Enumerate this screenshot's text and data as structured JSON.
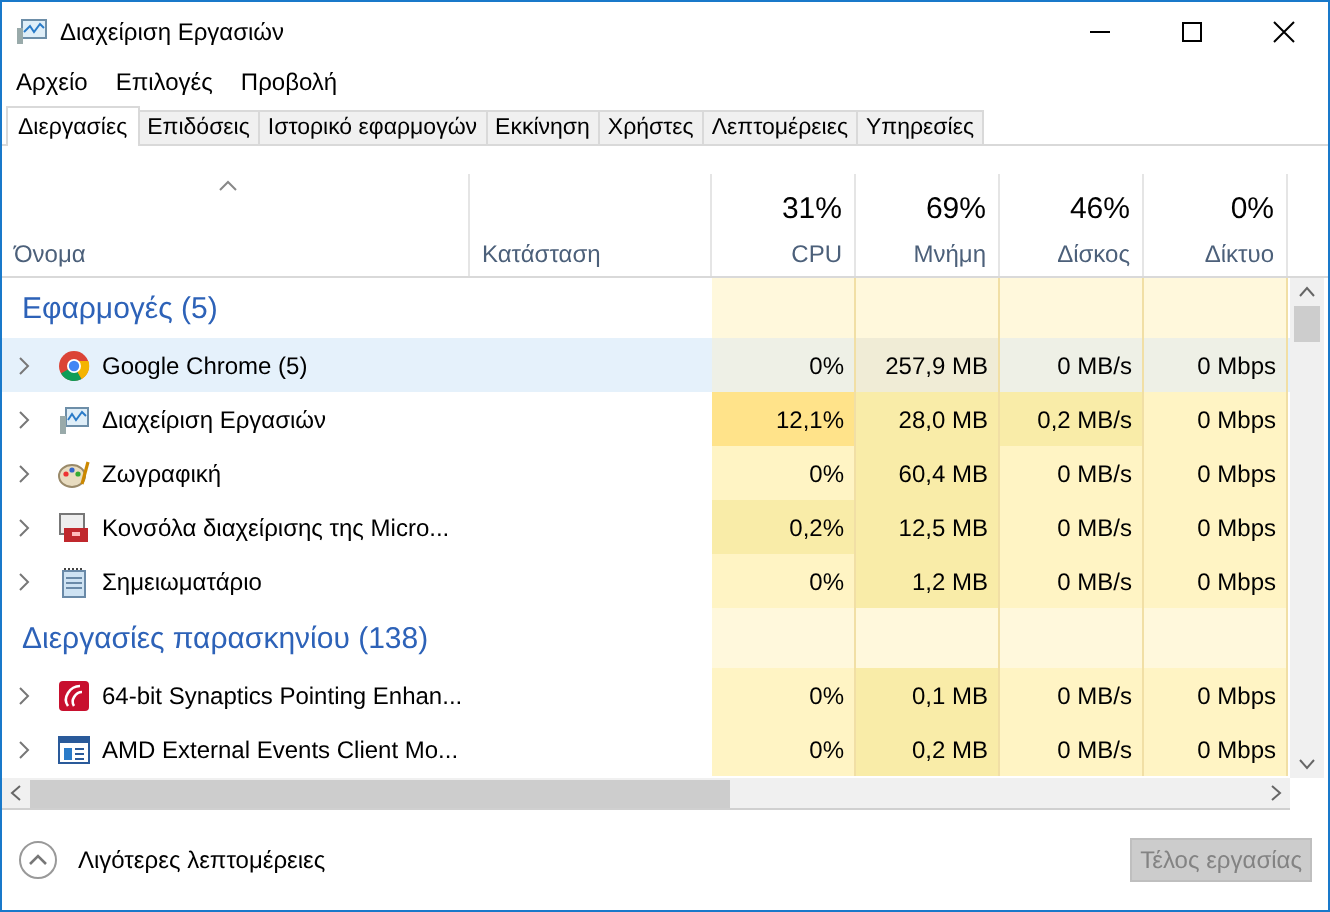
{
  "window": {
    "title": "Διαχείριση Εργασιών"
  },
  "menu": [
    "Αρχείο",
    "Επιλογές",
    "Προβολή"
  ],
  "tabs": [
    {
      "label": "Διεργασίες",
      "selected": true
    },
    {
      "label": "Επιδόσεις",
      "selected": false
    },
    {
      "label": "Ιστορικό εφαρμογών",
      "selected": false
    },
    {
      "label": "Εκκίνηση",
      "selected": false
    },
    {
      "label": "Χρήστες",
      "selected": false
    },
    {
      "label": "Λεπτομέρειες",
      "selected": false
    },
    {
      "label": "Υπηρεσίες",
      "selected": false
    }
  ],
  "table": {
    "columns": [
      {
        "label": "Όνομα"
      },
      {
        "label": "Κατάσταση"
      },
      {
        "label": "CPU",
        "total": "31%"
      },
      {
        "label": "Μνήμη",
        "total": "69%"
      },
      {
        "label": "Δίσκος",
        "total": "46%"
      },
      {
        "label": "Δίκτυο",
        "total": "0%"
      }
    ],
    "groups": [
      {
        "title": "Εφαρμογές (5)",
        "rows": [
          {
            "name": "Google Chrome (5)",
            "kind": "chrome",
            "selected": true,
            "cells": [
              {
                "text": "0%",
                "color": "#eef0e6"
              },
              {
                "text": "257,9 MB",
                "color": "#f0ecd6"
              },
              {
                "text": "0 MB/s",
                "color": "#eef0e6"
              },
              {
                "text": "0 Mbps",
                "color": "#eef0e6"
              }
            ]
          },
          {
            "name": "Διαχείριση Εργασιών",
            "kind": "taskmgr",
            "selected": false,
            "cells": [
              {
                "text": "12,1%",
                "color": "#ffe38a"
              },
              {
                "text": "28,0 MB",
                "color": "#f9eca8"
              },
              {
                "text": "0,2 MB/s",
                "color": "#f9eca8"
              },
              {
                "text": "0 Mbps",
                "color": "#fff4c4"
              }
            ]
          },
          {
            "name": "Ζωγραφική",
            "kind": "paint",
            "selected": false,
            "cells": [
              {
                "text": "0%",
                "color": "#fff4c4"
              },
              {
                "text": "60,4 MB",
                "color": "#f9eca8"
              },
              {
                "text": "0 MB/s",
                "color": "#fff4c4"
              },
              {
                "text": "0 Mbps",
                "color": "#fff4c4"
              }
            ]
          },
          {
            "name": "Κονσόλα διαχείρισης της Micro...",
            "kind": "console",
            "selected": false,
            "cells": [
              {
                "text": "0,2%",
                "color": "#f9eca8"
              },
              {
                "text": "12,5 MB",
                "color": "#f9eca8"
              },
              {
                "text": "0 MB/s",
                "color": "#fff4c4"
              },
              {
                "text": "0 Mbps",
                "color": "#fff4c4"
              }
            ]
          },
          {
            "name": "Σημειωματάριο",
            "kind": "notepad",
            "selected": false,
            "cells": [
              {
                "text": "0%",
                "color": "#fff4c4"
              },
              {
                "text": "1,2 MB",
                "color": "#f9eca8"
              },
              {
                "text": "0 MB/s",
                "color": "#fff4c4"
              },
              {
                "text": "0 Mbps",
                "color": "#fff4c4"
              }
            ]
          }
        ]
      },
      {
        "title": "Διεργασίες παρασκηνίου (138)",
        "rows": [
          {
            "name": "64-bit Synaptics Pointing Enhan...",
            "kind": "synaptics",
            "selected": false,
            "cells": [
              {
                "text": "0%",
                "color": "#fff4c4"
              },
              {
                "text": "0,1 MB",
                "color": "#f9eca8"
              },
              {
                "text": "0 MB/s",
                "color": "#fff4c4"
              },
              {
                "text": "0 Mbps",
                "color": "#fff4c4"
              }
            ]
          },
          {
            "name": "AMD External Events Client Mo...",
            "kind": "service",
            "selected": false,
            "cells": [
              {
                "text": "0%",
                "color": "#fff4c4"
              },
              {
                "text": "0,2 MB",
                "color": "#f9eca8"
              },
              {
                "text": "0 MB/s",
                "color": "#fff4c4"
              },
              {
                "text": "0 Mbps",
                "color": "#fff4c4"
              }
            ]
          }
        ]
      }
    ]
  },
  "footer": {
    "details_link": "Λιγότερες λεπτομέρειες",
    "end_task_button": {
      "label": "Τέλος εργασίας",
      "disabled": true
    }
  }
}
